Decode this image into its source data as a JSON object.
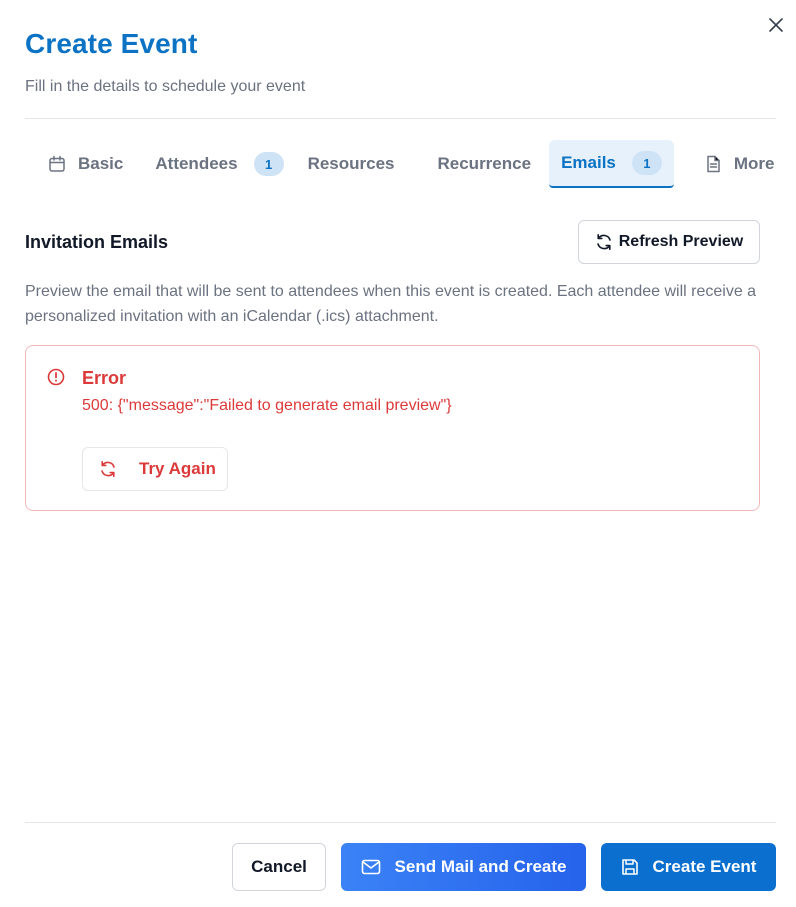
{
  "dialog": {
    "title": "Create Event",
    "subtitle": "Fill in the details to schedule your event",
    "close_icon": "close-icon"
  },
  "tabs": [
    {
      "label": "Basic",
      "icon": "calendar-icon",
      "badge": null,
      "active": false
    },
    {
      "label": "Attendees",
      "icon": null,
      "badge": "1",
      "active": false
    },
    {
      "label": "Resources",
      "icon": null,
      "badge": null,
      "active": false
    },
    {
      "label": "Recurrence",
      "icon": null,
      "badge": null,
      "active": false
    },
    {
      "label": "Emails",
      "icon": null,
      "badge": "1",
      "active": true
    },
    {
      "label": "More",
      "icon": "document-icon",
      "badge": null,
      "active": false
    }
  ],
  "emails": {
    "section_title": "Invitation Emails",
    "refresh_label": "Refresh Preview",
    "description": "Preview the email that will be sent to attendees when this event is created. Each attendee will receive a personalized invitation with an iCalendar (.ics) attachment.",
    "error": {
      "title": "Error",
      "message": "500: {\"message\":\"Failed to generate email preview\"}",
      "retry_label": "Try Again"
    }
  },
  "footer": {
    "cancel_label": "Cancel",
    "send_label": "Send Mail and Create",
    "create_label": "Create Event"
  },
  "colors": {
    "brand": "#0b72c4",
    "error": "#dc3a3a",
    "active_tab_bg": "#e6f1fc"
  }
}
